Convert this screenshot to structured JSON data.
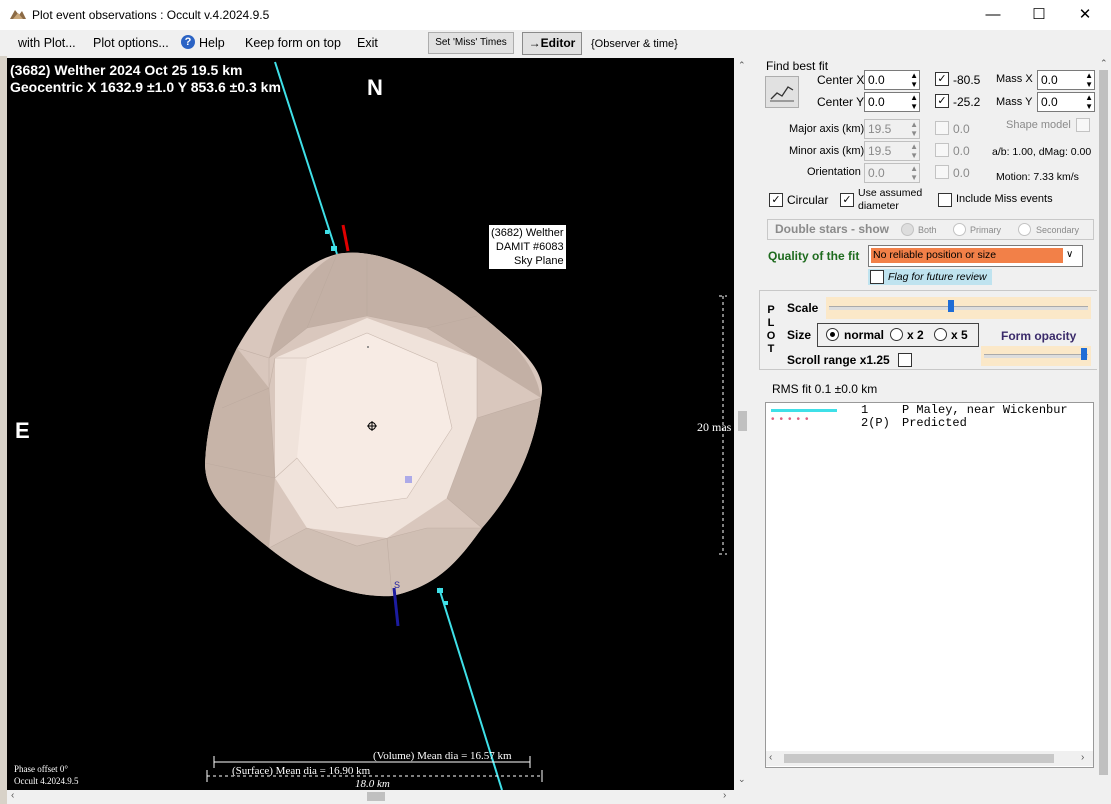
{
  "window": {
    "title": "Plot event observations : Occult v.4.2024.9.5",
    "minimize_icon": "minimize-icon",
    "maximize_icon": "maximize-icon",
    "close_icon": "close-icon"
  },
  "menu": {
    "with_plot": "with Plot...",
    "plot_options": "Plot options...",
    "help": "Help",
    "keep_on_top": "Keep form on top",
    "exit": "Exit",
    "set_miss_times": "Set 'Miss' Times",
    "editor": "→Editor",
    "observer_time": "{Observer & time}"
  },
  "plot": {
    "header_line1": "(3682) Welther  2024 Oct 25   19.5 km",
    "header_line2": "Geocentric  X  1632.9 ±1.0  Y 853.6 ±0.3 km",
    "north": "N",
    "east": "E",
    "label_name": "(3682) Welther",
    "label_model": "DAMIT #6083",
    "label_plane": "Sky Plane",
    "scale_mas": "20 mas",
    "volume_dia": "(Volume) Mean dia = 16.57 km",
    "surface_dia": "(Surface) Mean dia = 16.90 km",
    "width_km": "18.0  km",
    "phase_offset": "Phase offset 0°",
    "version": "Occult 4.2024.9.5",
    "colors": {
      "chord": "#3fe0e8",
      "predicted": "#e06080",
      "body": "#d9c7bd"
    }
  },
  "fit": {
    "find_best_fit": "Find best fit",
    "center_x_label": "Center X",
    "center_x": "0.0",
    "center_y_label": "Center Y",
    "center_y": "0.0",
    "x_value": "-80.5",
    "y_value": "-25.2",
    "mass_x_label": "Mass X",
    "mass_x": "0.0",
    "mass_y_label": "Mass Y",
    "mass_y": "0.0",
    "major_label": "Major axis (km)",
    "major": "19.5",
    "major_chk": "0.0",
    "minor_label": "Minor axis (km)",
    "minor": "19.5",
    "minor_chk": "0.0",
    "orient_label": "Orientation",
    "orient": "0.0",
    "orient_chk": "0.0",
    "shape_model": "Shape model",
    "ab_dmag": "a/b: 1.00, dMag: 0.00",
    "motion": "Motion: 7.33 km/s",
    "circular": "Circular",
    "use_assumed": "Use assumed",
    "diameter": "diameter",
    "include_miss": "Include Miss events",
    "double_stars": "Double stars - show",
    "both": "Both",
    "primary": "Primary",
    "secondary": "Secondary",
    "quality_label": "Quality of the fit",
    "quality_value": "No reliable position or size",
    "flag_review": "Flag for future review"
  },
  "plotbox": {
    "letters": [
      "P",
      "L",
      "O",
      "T"
    ],
    "scale": "Scale",
    "size": "Size",
    "normal": "normal",
    "x2": "x 2",
    "x5": "x 5",
    "form_opacity": "Form opacity",
    "scroll_range": "Scroll range x1.25"
  },
  "rms": "RMS fit 0.1 ±0.0 km",
  "legend": [
    {
      "num": "1",
      "name": "P Maley, near Wickenbur"
    },
    {
      "num": "2(P)",
      "name": "Predicted"
    }
  ]
}
